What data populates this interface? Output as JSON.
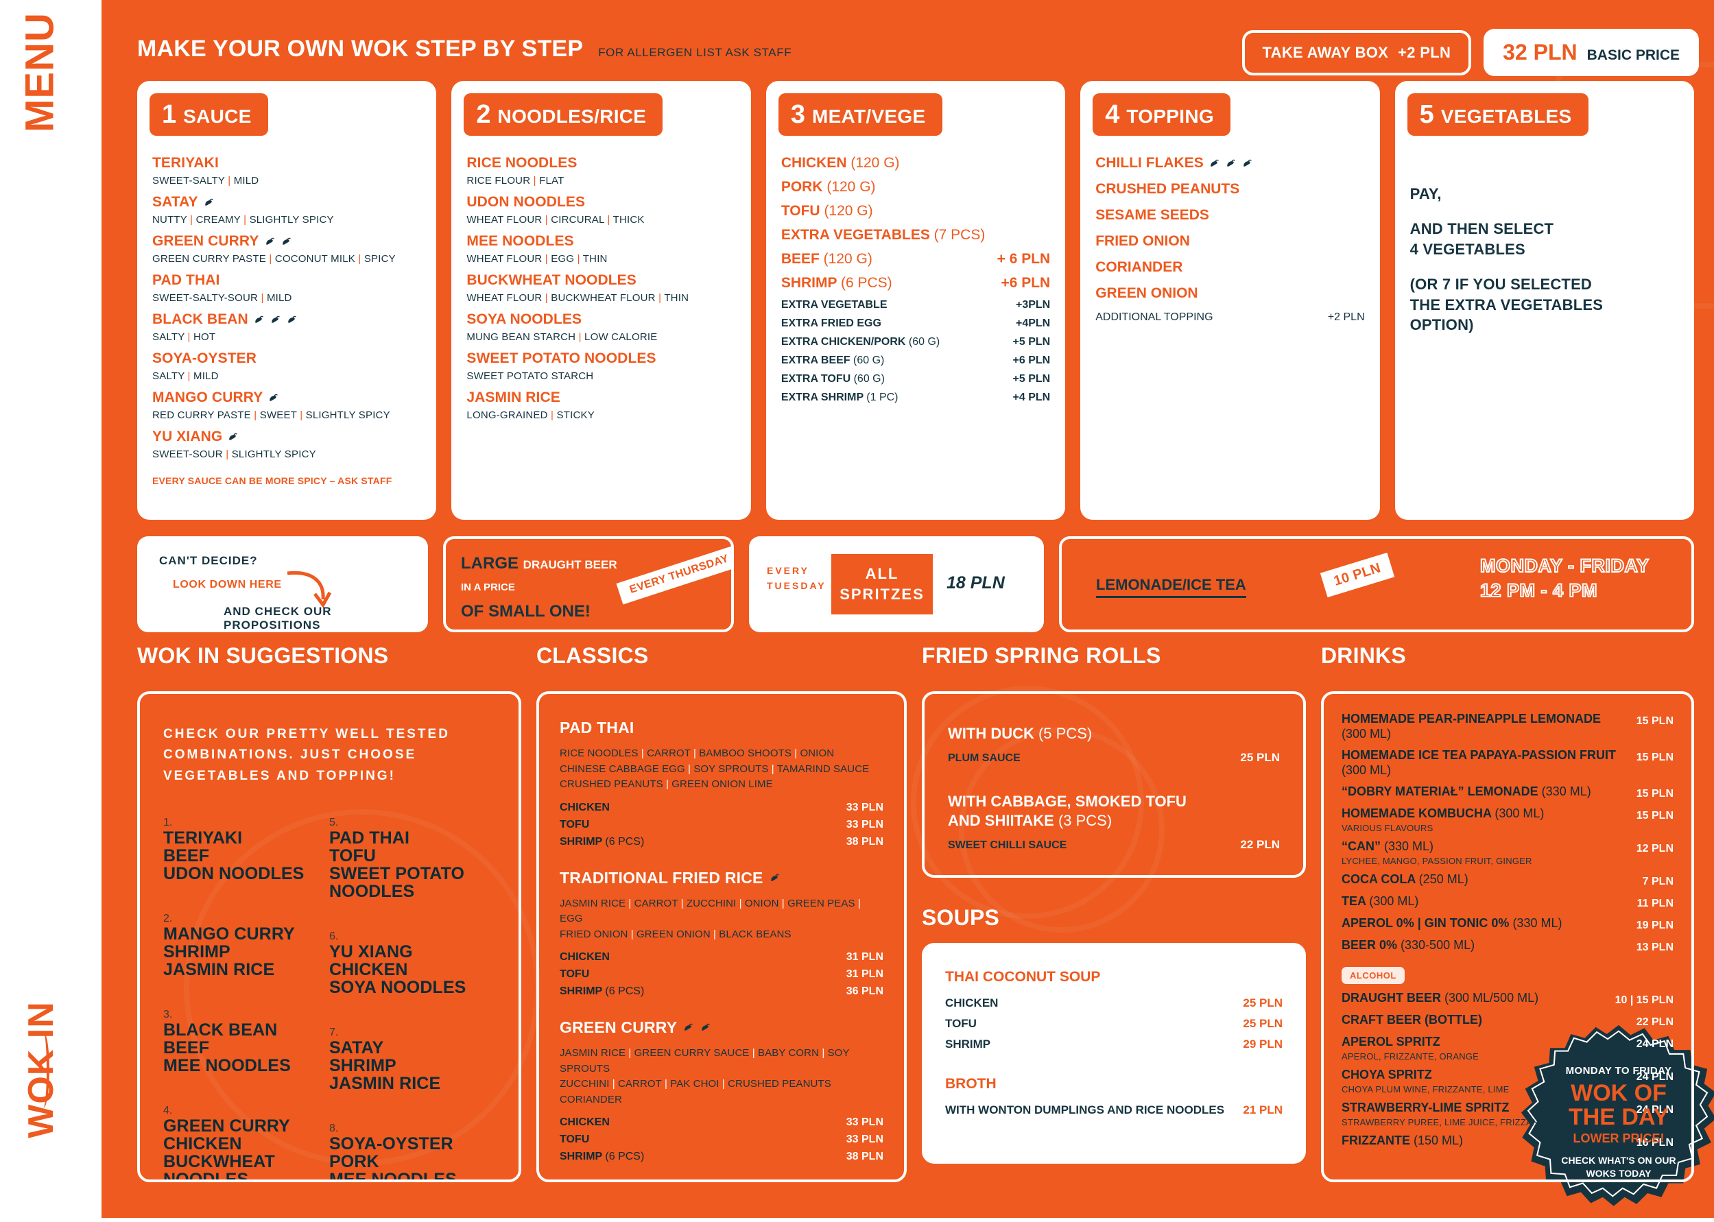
{
  "rail": {
    "menu": "MENU",
    "wok_in": "WOK IN"
  },
  "header": {
    "title": "MAKE YOUR OWN WOK STEP BY STEP",
    "subtitle": "FOR ALLERGEN LIST ASK STAFF",
    "take_away_label": "TAKE AWAY BOX",
    "take_away_price": "+2 PLN",
    "basic_price": "32 PLN",
    "basic_price_label": "BASIC PRICE"
  },
  "steps": [
    {
      "number": "1",
      "title": "SAUCE",
      "items": [
        {
          "name": "TERIYAKI",
          "chili": 0,
          "desc": [
            "SWEET-SALTY",
            "MILD"
          ]
        },
        {
          "name": "SATAY",
          "chili": 1,
          "desc": [
            "NUTTY",
            "CREAMY",
            "SLIGHTLY SPICY"
          ]
        },
        {
          "name": "GREEN CURRY",
          "chili": 2,
          "desc": [
            "GREEN CURRY PASTE",
            "COCONUT MILK",
            "SPICY"
          ]
        },
        {
          "name": "PAD THAI",
          "chili": 0,
          "desc": [
            "SWEET-SALTY-SOUR",
            "MILD"
          ]
        },
        {
          "name": "BLACK BEAN",
          "chili": 3,
          "desc": [
            "SALTY",
            "HOT"
          ]
        },
        {
          "name": "SOYA-OYSTER",
          "chili": 0,
          "desc": [
            "SALTY",
            "MILD"
          ]
        },
        {
          "name": "MANGO CURRY",
          "chili": 1,
          "desc": [
            "RED CURRY PASTE",
            "SWEET",
            "SLIGHTLY SPICY"
          ]
        },
        {
          "name": "YU XIANG",
          "chili": 1,
          "desc": [
            "SWEET-SOUR",
            "SLIGHTLY SPICY"
          ]
        }
      ],
      "note": "EVERY SAUCE CAN BE MORE SPICY – ASK STAFF"
    },
    {
      "number": "2",
      "title": "NOODLES/RICE",
      "items": [
        {
          "name": "RICE NOODLES",
          "chili": 0,
          "desc": [
            "RICE FLOUR",
            "FLAT"
          ]
        },
        {
          "name": "UDON NOODLES",
          "chili": 0,
          "desc": [
            "WHEAT FLOUR",
            "CIRCURAL",
            "THICK"
          ]
        },
        {
          "name": "MEE NOODLES",
          "chili": 0,
          "desc": [
            "WHEAT FLOUR",
            "EGG",
            "THIN"
          ]
        },
        {
          "name": "BUCKWHEAT NOODLES",
          "chili": 0,
          "desc": [
            "WHEAT FLOUR",
            "BUCKWHEAT FLOUR",
            "THIN"
          ]
        },
        {
          "name": "SOYA NOODLES",
          "chili": 0,
          "desc": [
            "MUNG BEAN STARCH",
            "LOW CALORIE"
          ]
        },
        {
          "name": "SWEET POTATO NOODLES",
          "chili": 0,
          "desc": [
            "SWEET POTATO STARCH"
          ]
        },
        {
          "name": "JASMIN RICE",
          "chili": 0,
          "desc": [
            "LONG-GRAINED",
            "STICKY"
          ]
        }
      ],
      "note": ""
    },
    {
      "number": "3",
      "title": "MEAT/VEGE",
      "main_rows": [
        {
          "name": "CHICKEN",
          "gram": "(120 G)",
          "price": ""
        },
        {
          "name": "PORK",
          "gram": "(120 G)",
          "price": ""
        },
        {
          "name": "TOFU",
          "gram": "(120 G)",
          "price": ""
        },
        {
          "name": "EXTRA VEGETABLES",
          "gram": "(7 PCS)",
          "price": ""
        },
        {
          "name": "BEEF",
          "gram": "(120 G)",
          "price": "+ 6 PLN"
        },
        {
          "name": "SHRIMP",
          "gram": "(6 PCS)",
          "price": "+6 PLN"
        }
      ],
      "extra_rows": [
        {
          "name": "EXTRA VEGETABLE",
          "gram": "",
          "price": "+3PLN"
        },
        {
          "name": "EXTRA FRIED EGG",
          "gram": "",
          "price": "+4PLN"
        },
        {
          "name": "EXTRA CHICKEN/PORK",
          "gram": "(60 G)",
          "price": "+5 PLN"
        },
        {
          "name": "EXTRA BEEF",
          "gram": "(60 G)",
          "price": "+6 PLN"
        },
        {
          "name": "EXTRA TOFU",
          "gram": "(60 G)",
          "price": "+5 PLN"
        },
        {
          "name": "EXTRA SHRIMP",
          "gram": "(1 PC)",
          "price": "+4 PLN"
        }
      ]
    },
    {
      "number": "4",
      "title": "TOPPING",
      "toppings": [
        {
          "name": "CHILLI FLAKES",
          "chili": 3
        },
        {
          "name": "CRUSHED PEANUTS",
          "chili": 0
        },
        {
          "name": "SESAME SEEDS",
          "chili": 0
        },
        {
          "name": "FRIED ONION",
          "chili": 0
        },
        {
          "name": "CORIANDER",
          "chili": 0
        },
        {
          "name": "GREEN ONION",
          "chili": 0
        }
      ],
      "additional_label": "ADDITIONAL TOPPING",
      "additional_price": "+2 PLN"
    },
    {
      "number": "5",
      "title": "VEGETABLES",
      "lines": [
        "PAY,",
        "AND THEN SELECT\n4 VEGETABLES",
        "(OR 7 IF YOU SELECTED\nTHE EXTRA VEGETABLES\nOPTION)"
      ]
    }
  ],
  "wok_of_day": {
    "line1": "MONDAY TO FRIDAY",
    "line2": "WOK OF\nTHE DAY",
    "line3": "LOWER PRICE!",
    "line4": "CHECK WHAT'S ON OUR\nWOKS TODAY"
  },
  "promos": {
    "cant_decide": {
      "a": "CAN'T DECIDE?",
      "b": "LOOK DOWN HERE",
      "c": "AND CHECK OUR PROPOSITIONS"
    },
    "beer": {
      "big": "LARGE",
      "rest": "DRAUGHT BEER",
      "line2": "IN A PRICE",
      "line3": "OF SMALL ONE!",
      "ribbon": "EVERY THURSDAY"
    },
    "spritz": {
      "every": "EVERY\nTUESDAY",
      "box1": "ALL",
      "box2": "SPRITZES",
      "price": "18 PLN"
    },
    "lemonade": {
      "label": "LEMONADE/ICE TEA",
      "ribbon": "10 PLN",
      "hours": "MONDAY - FRIDAY\n12 PM - 4 PM"
    }
  },
  "sections": {
    "suggestions_title": "WOK IN SUGGESTIONS",
    "classics_title": "CLASSICS",
    "spring_rolls_title": "FRIED SPRING ROLLS",
    "soups_title": "SOUPS",
    "drinks_title": "DRINKS"
  },
  "suggestions": {
    "intro": "CHECK OUR PRETTY WELL TESTED COMBINATIONS. JUST CHOOSE VEGETABLES AND TOPPING!",
    "items": [
      {
        "num": "1.",
        "lines": [
          "TERIYAKI",
          "BEEF",
          "UDON NOODLES"
        ]
      },
      {
        "num": "2.",
        "lines": [
          "MANGO CURRY",
          "SHRIMP",
          "JASMIN RICE"
        ]
      },
      {
        "num": "3.",
        "lines": [
          "BLACK BEAN",
          "BEEF",
          "MEE NOODLES"
        ]
      },
      {
        "num": "4.",
        "lines": [
          "GREEN CURRY",
          "CHICKEN",
          "BUCKWHEAT NOODLES"
        ]
      },
      {
        "num": "5.",
        "lines": [
          "PAD THAI",
          "TOFU",
          "SWEET POTATO NOODLES"
        ]
      },
      {
        "num": "6.",
        "lines": [
          "YU XIANG",
          "CHICKEN",
          "SOYA NOODLES"
        ]
      },
      {
        "num": "7.",
        "lines": [
          "SATAY",
          "SHRIMP",
          "JASMIN RICE"
        ]
      },
      {
        "num": "8.",
        "lines": [
          "SOYA-OYSTER",
          "PORK",
          "MEE NOODLES"
        ]
      }
    ]
  },
  "classics": [
    {
      "name": "PAD THAI",
      "chili": 0,
      "ingredients": [
        "RICE NOODLES | CARROT | BAMBOO SHOOTS | ONION",
        "CHINESE CABBAGE EGG | SOY SPROUTS | TAMARIND SAUCE",
        "CRUSHED PEANUTS | GREEN ONION LIME"
      ],
      "options": [
        {
          "name": "CHICKEN",
          "gram": "",
          "price": "33 PLN"
        },
        {
          "name": "TOFU",
          "gram": "",
          "price": "33 PLN"
        },
        {
          "name": "SHRIMP",
          "gram": "(6 PCS)",
          "price": "38 PLN"
        }
      ]
    },
    {
      "name": "TRADITIONAL FRIED RICE",
      "chili": 1,
      "ingredients": [
        "JASMIN RICE | CARROT | ZUCCHINI | ONION | GREEN PEAS | EGG",
        "FRIED ONION | GREEN ONION | BLACK BEANS"
      ],
      "options": [
        {
          "name": "CHICKEN",
          "gram": "",
          "price": "31 PLN"
        },
        {
          "name": "TOFU",
          "gram": "",
          "price": "31 PLN"
        },
        {
          "name": "SHRIMP",
          "gram": "(6 PCS)",
          "price": "36 PLN"
        }
      ]
    },
    {
      "name": "GREEN CURRY",
      "chili": 2,
      "ingredients": [
        "JASMIN RICE | GREEN CURRY SAUCE | BABY CORN | SOY SPROUTS",
        "ZUCCHINI | CARROT | PAK CHOI | CRUSHED PEANUTS",
        "CORIANDER"
      ],
      "options": [
        {
          "name": "CHICKEN",
          "gram": "",
          "price": "33 PLN"
        },
        {
          "name": "TOFU",
          "gram": "",
          "price": "33 PLN"
        },
        {
          "name": "SHRIMP",
          "gram": "(6 PCS)",
          "price": "38 PLN"
        }
      ]
    }
  ],
  "spring_rolls": [
    {
      "title": "WITH DUCK",
      "gram": "(5 PCS)",
      "sauce": "PLUM SAUCE",
      "price": "25 PLN"
    },
    {
      "title": "WITH CABBAGE, SMOKED TOFU\nAND SHIITAKE",
      "gram": "(3 PCS)",
      "sauce": "SWEET CHILLI SAUCE",
      "price": "22 PLN"
    }
  ],
  "soups": [
    {
      "heading": "THAI COCONUT SOUP",
      "rows": [
        {
          "name": "CHICKEN",
          "price": "25 PLN"
        },
        {
          "name": "TOFU",
          "price": "25 PLN"
        },
        {
          "name": "SHRIMP",
          "price": "29 PLN"
        }
      ]
    },
    {
      "heading": "BROTH",
      "rows": [
        {
          "name": "WITH WONTON DUMPLINGS AND RICE NOODLES",
          "price": "21 PLN"
        }
      ]
    }
  ],
  "drinks": {
    "soft": [
      {
        "name": "HOMEMADE PEAR-PINEAPPLE LEMONADE",
        "gram": "(300 ML)",
        "desc": "",
        "price": "15 PLN"
      },
      {
        "name": "HOMEMADE ICE TEA PAPAYA-PASSION FRUIT",
        "gram": "(300 ML)",
        "desc": "",
        "price": "15 PLN"
      },
      {
        "name": "“DOBRY MATERIAŁ” LEMONADE",
        "gram": "(330 ML)",
        "desc": "",
        "price": "15 PLN"
      },
      {
        "name": "HOMEMADE KOMBUCHA",
        "gram": "(300 ML)",
        "desc": "VARIOUS FLAVOURS",
        "price": "15 PLN"
      },
      {
        "name": "“CAN”",
        "gram": "(330 ML)",
        "desc": "LYCHEE, MANGO, PASSION FRUIT, GINGER",
        "price": "12 PLN"
      },
      {
        "name": "COCA COLA",
        "gram": "(250 ML)",
        "desc": "",
        "price": "7 PLN"
      },
      {
        "name": "TEA",
        "gram": "(300 ML)",
        "desc": "",
        "price": "11 PLN"
      },
      {
        "name": "APEROL 0% | GIN TONIC 0%",
        "gram": "(330 ML)",
        "desc": "",
        "price": "19 PLN"
      },
      {
        "name": "BEER 0%",
        "gram": "(330-500 ML)",
        "desc": "",
        "price": "13 PLN"
      }
    ],
    "alcohol_tag": "ALCOHOL",
    "alcohol": [
      {
        "name": "DRAUGHT BEER",
        "gram": "(300 ML/500 ML)",
        "desc": "",
        "price": "10 | 15 PLN"
      },
      {
        "name": "CRAFT BEER (BOTTLE)",
        "gram": "",
        "desc": "",
        "price": "22 PLN"
      },
      {
        "name": "APEROL SPRITZ",
        "gram": "",
        "desc": "APEROL, FRIZZANTE, ORANGE",
        "price": "24 PLN"
      },
      {
        "name": "CHOYA SPRITZ",
        "gram": "",
        "desc": "CHOYA PLUM WINE, FRIZZANTE, LIME",
        "price": "24 PLN"
      },
      {
        "name": "STRAWBERRY-LIME SPRITZ",
        "gram": "",
        "desc": "STRAWBERRY PUREE, LIME JUICE, FRIZZANTE",
        "price": "24 PLN"
      },
      {
        "name": "FRIZZANTE",
        "gram": "(150 ML)",
        "desc": "",
        "price": "16 PLN"
      }
    ]
  },
  "colors": {
    "brand_orange": "#ee5a1f",
    "dark_teal": "#163440",
    "white": "#ffffff"
  }
}
